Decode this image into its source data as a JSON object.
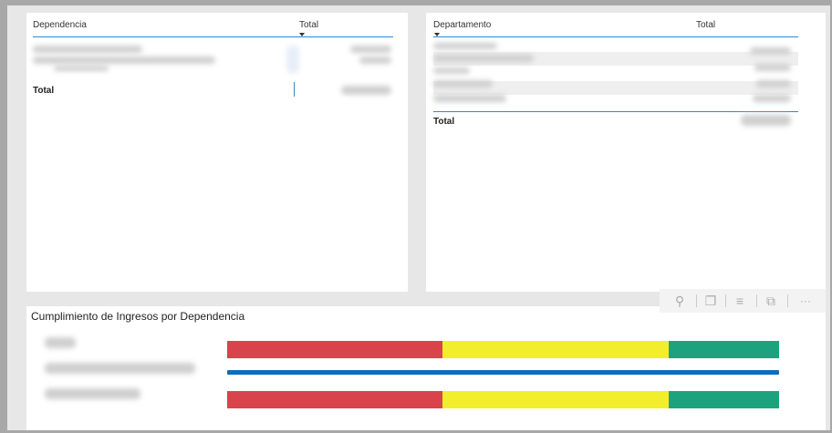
{
  "table_left": {
    "col_dependencia": "Dependencia",
    "col_total": "Total",
    "total_label": "Total"
  },
  "table_right": {
    "col_departamento": "Departamento",
    "col_total": "Total",
    "total_label": "Total"
  },
  "visual_toolbar": {
    "pin_icon": "pin-icon",
    "copy_icon": "copy-icon",
    "filter_icon": "filter-icon",
    "focus_icon": "focus-mode-icon",
    "more_icon": "more-options-icon",
    "more_label": "···"
  },
  "chart": {
    "title": "Cumplimiento de Ingresos por Dependencia"
  },
  "chart_data": {
    "type": "bar",
    "title": "Cumplimiento de Ingresos por Dependencia",
    "rows": [
      {
        "segments": [
          {
            "color": "#d9434b",
            "value": 39
          },
          {
            "color": "#f2ee2b",
            "value": 41
          },
          {
            "color": "#1ca37e",
            "value": 20
          }
        ]
      },
      {
        "segments": [
          {
            "color": "#0f6cbd",
            "value": 100
          }
        ],
        "style": "thin"
      },
      {
        "segments": [
          {
            "color": "#d9434b",
            "value": 39
          },
          {
            "color": "#f2ee2b",
            "value": 41
          },
          {
            "color": "#1ca37e",
            "value": 20
          }
        ]
      }
    ]
  }
}
